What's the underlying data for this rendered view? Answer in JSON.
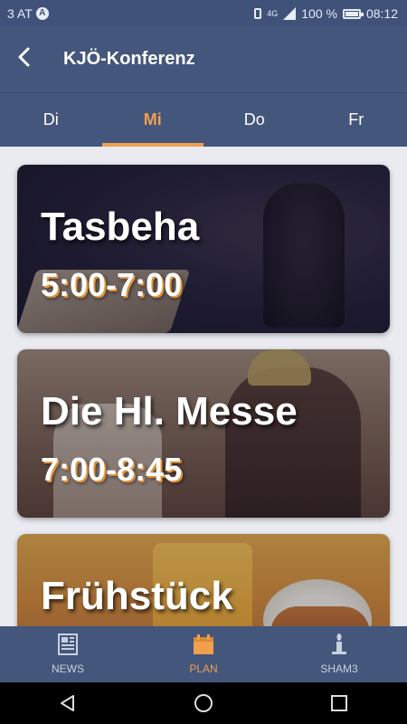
{
  "status_bar": {
    "carrier": "3 AT",
    "network": "4G",
    "battery": "100 %",
    "time": "08:12",
    "battery_level": 1.0
  },
  "app_bar": {
    "title": "KJÖ-Konferenz",
    "back_icon": "back-arrow-icon"
  },
  "tabs": [
    {
      "label": "Di",
      "active": false
    },
    {
      "label": "Mi",
      "active": true
    },
    {
      "label": "Do",
      "active": false
    },
    {
      "label": "Fr",
      "active": false
    }
  ],
  "events": [
    {
      "title": "Tasbeha",
      "time": "5:00-7:00"
    },
    {
      "title": "Die Hl. Messe",
      "time": "7:00-8:45"
    },
    {
      "title": "Frühstück",
      "time": ""
    }
  ],
  "bottom_nav": [
    {
      "label": "NEWS",
      "icon": "newspaper-icon",
      "active": false
    },
    {
      "label": "PLAN",
      "icon": "calendar-icon",
      "active": true
    },
    {
      "label": "SHAM3",
      "icon": "candle-icon",
      "active": false
    }
  ],
  "colors": {
    "primary": "#44567c",
    "accent": "#f0a04c",
    "background": "#e9ebf0"
  }
}
